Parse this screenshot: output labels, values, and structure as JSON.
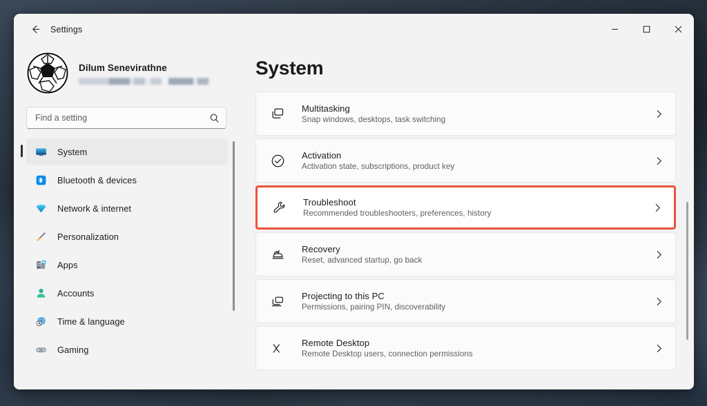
{
  "window": {
    "title": "Settings",
    "back_label": "Back",
    "controls": {
      "minimize": "Minimize",
      "maximize": "Maximize",
      "close": "Close"
    }
  },
  "account": {
    "name": "Dilum Senevirathne",
    "email_redacted": "",
    "avatar_icon": "soccer-ball-avatar"
  },
  "search": {
    "placeholder": "Find a setting",
    "value": "",
    "icon": "search-icon"
  },
  "sidebar": {
    "items": [
      {
        "label": "System",
        "icon": "monitor-icon",
        "active": true
      },
      {
        "label": "Bluetooth & devices",
        "icon": "bluetooth-icon",
        "active": false
      },
      {
        "label": "Network & internet",
        "icon": "wifi-icon",
        "active": false
      },
      {
        "label": "Personalization",
        "icon": "paintbrush-icon",
        "active": false
      },
      {
        "label": "Apps",
        "icon": "apps-icon",
        "active": false
      },
      {
        "label": "Accounts",
        "icon": "person-icon",
        "active": false
      },
      {
        "label": "Time & language",
        "icon": "clock-globe-icon",
        "active": false
      },
      {
        "label": "Gaming",
        "icon": "gamepad-icon",
        "active": false
      }
    ]
  },
  "main": {
    "title": "System",
    "cards": [
      {
        "title": "Multitasking",
        "subtitle": "Snap windows, desktops, task switching",
        "icon": "windows-stack-icon",
        "highlighted": false
      },
      {
        "title": "Activation",
        "subtitle": "Activation state, subscriptions, product key",
        "icon": "check-circle-icon",
        "highlighted": false
      },
      {
        "title": "Troubleshoot",
        "subtitle": "Recommended troubleshooters, preferences, history",
        "icon": "wrench-icon",
        "highlighted": true
      },
      {
        "title": "Recovery",
        "subtitle": "Reset, advanced startup, go back",
        "icon": "recovery-pc-icon",
        "highlighted": false
      },
      {
        "title": "Projecting to this PC",
        "subtitle": "Permissions, pairing PIN, discoverability",
        "icon": "project-screen-icon",
        "highlighted": false
      },
      {
        "title": "Remote Desktop",
        "subtitle": "Remote Desktop users, connection permissions",
        "icon": "remote-desktop-icon",
        "highlighted": false
      }
    ]
  },
  "colors": {
    "highlight_border": "#e9543c",
    "window_background": "#f3f3f3",
    "card_background": "#fbfbfb",
    "accent_text": "#1a1a1a"
  }
}
